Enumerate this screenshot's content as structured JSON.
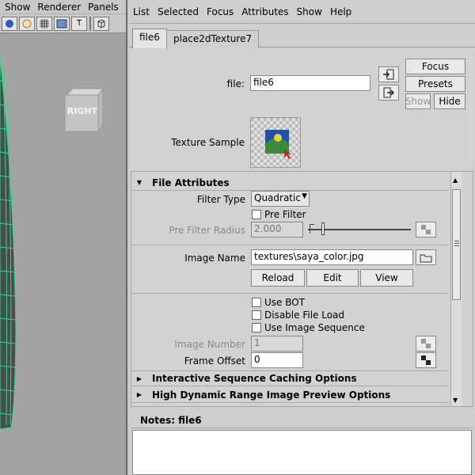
{
  "viewport": {
    "menu": [
      "Show",
      "Renderer",
      "Panels"
    ],
    "toolbar_text_icon": "T",
    "view_cube_label": "RIGHT"
  },
  "editor": {
    "menu": [
      "List",
      "Selected",
      "Focus",
      "Attributes",
      "Show",
      "Help"
    ],
    "tabs": [
      "file6",
      "place2dTexture7"
    ],
    "file_label": "file:",
    "file_value": "file6",
    "focus_btn": "Focus",
    "presets_btn": "Presets",
    "show_btn": "Show",
    "hide_btn": "Hide",
    "texture_sample_label": "Texture Sample",
    "sections": {
      "file_attributes": "File Attributes",
      "interactive": "Interactive Sequence Caching Options",
      "hdr": "High Dynamic Range Image Preview Options"
    },
    "filter_type_label": "Filter Type",
    "filter_type_value": "Quadratic",
    "pre_filter_label": "Pre Filter",
    "pre_filter_radius_label": "Pre Filter Radius",
    "pre_filter_radius_value": "2.000",
    "image_name_label": "Image Name",
    "image_name_value": "textures\\saya_color.jpg",
    "reload_btn": "Reload",
    "edit_btn": "Edit",
    "view_btn": "View",
    "use_bot": "Use BOT",
    "disable_file_load": "Disable File Load",
    "use_image_sequence": "Use Image Sequence",
    "image_number_label": "Image Number",
    "image_number_value": "1",
    "frame_offset_label": "Frame Offset",
    "frame_offset_value": "0",
    "notes_label": "Notes:",
    "notes_node": "file6"
  },
  "colors": {
    "wireframe": "#2fd98f",
    "accent_blue": "#1f4fa8"
  }
}
